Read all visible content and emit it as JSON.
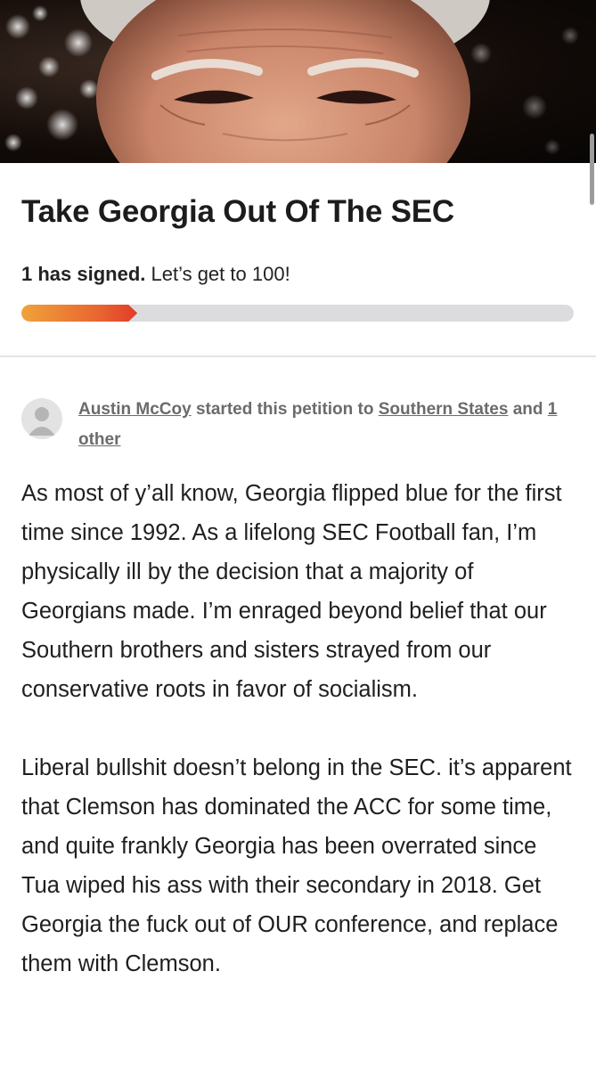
{
  "petition": {
    "title": "Take Georgia Out Of The SEC",
    "signed_count": "1 has signed.",
    "goal_text": "Let’s get to 100!",
    "progress_fraction": 0.21
  },
  "starter": {
    "name": "Austin McCoy",
    "started_text": "started this petition to",
    "target": "Southern States",
    "and_text": "and",
    "others": "1 other"
  },
  "body": {
    "paragraphs": [
      "As most of y’all know, Georgia flipped blue for the first time since 1992. As a lifelong SEC Football fan, I’m physically ill by the decision that a majority of Georgians made. I’m enraged beyond belief that our Southern brothers and sisters strayed from our conservative roots in favor of socialism.",
      "Liberal bullshit doesn’t belong in the SEC. it’s apparent that Clemson has dominated the ACC for some time, and quite frankly Georgia has been overrated since Tua wiped his ass with their secondary in 2018. Get Georgia the fuck out of OUR conference, and replace them with Clemson."
    ]
  },
  "colors": {
    "progress_start": "#f0a33b",
    "progress_end": "#e23b2a",
    "track": "#dcdcdf",
    "link": "#6b6b6b"
  }
}
